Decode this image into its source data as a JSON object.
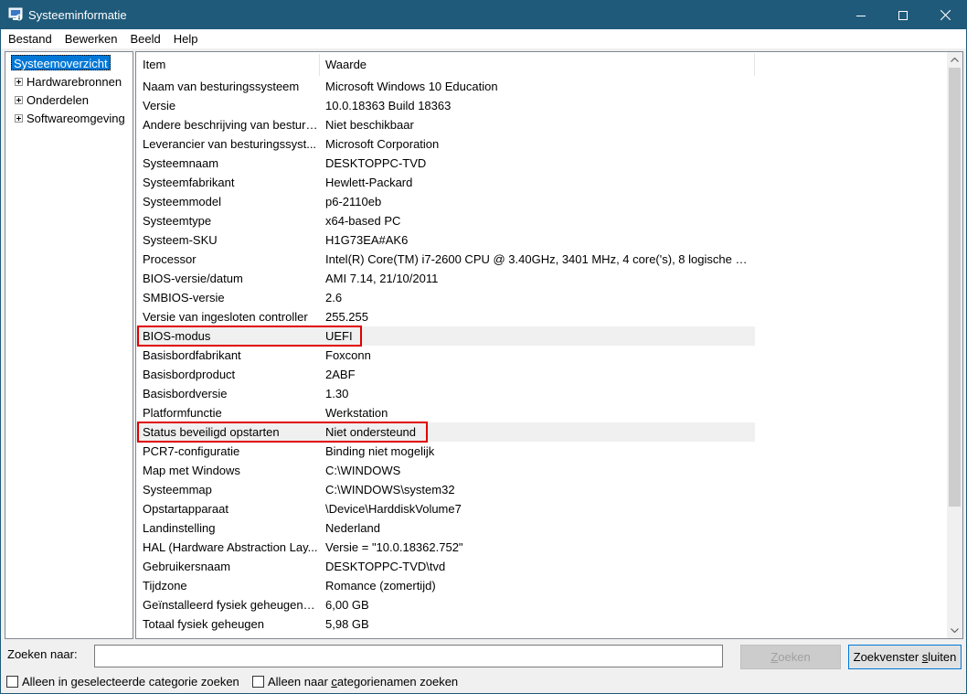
{
  "window": {
    "title": "Systeeminformatie",
    "accent_color": "#1f5a7a"
  },
  "menu": [
    "Bestand",
    "Bewerken",
    "Beeld",
    "Help"
  ],
  "tree": {
    "root": "Systeemoverzicht",
    "children": [
      "Hardwarebronnen",
      "Onderdelen",
      "Softwareomgeving"
    ]
  },
  "table": {
    "headers": [
      "Item",
      "Waarde"
    ],
    "rows": [
      [
        "Naam van besturingssysteem",
        "Microsoft Windows 10 Education"
      ],
      [
        "Versie",
        "10.0.18363 Build 18363"
      ],
      [
        "Andere beschrijving van besturi...",
        "Niet beschikbaar"
      ],
      [
        "Leverancier van besturingssyst...",
        "Microsoft Corporation"
      ],
      [
        "Systeemnaam",
        "DESKTOPPC-TVD"
      ],
      [
        "Systeemfabrikant",
        "Hewlett-Packard"
      ],
      [
        "Systeemmodel",
        "p6-2110eb"
      ],
      [
        "Systeemtype",
        "x64-based PC"
      ],
      [
        "Systeem-SKU",
        "H1G73EA#AK6"
      ],
      [
        "Processor",
        "Intel(R) Core(TM) i7-2600 CPU @ 3.40GHz, 3401 MHz, 4 core('s), 8 logische pr..."
      ],
      [
        "BIOS-versie/datum",
        "AMI 7.14, 21/10/2011"
      ],
      [
        "SMBIOS-versie",
        "2.6"
      ],
      [
        "Versie van ingesloten controller",
        "255.255"
      ],
      [
        "BIOS-modus",
        "UEFI"
      ],
      [
        "Basisbordfabrikant",
        "Foxconn"
      ],
      [
        "Basisbordproduct",
        "2ABF"
      ],
      [
        "Basisbordversie",
        "1.30"
      ],
      [
        "Platformfunctie",
        "Werkstation"
      ],
      [
        "Status beveiligd opstarten",
        "Niet ondersteund"
      ],
      [
        "PCR7-configuratie",
        "Binding niet mogelijk"
      ],
      [
        "Map met Windows",
        "C:\\WINDOWS"
      ],
      [
        "Systeemmap",
        "C:\\WINDOWS\\system32"
      ],
      [
        "Opstartapparaat",
        "\\Device\\HarddiskVolume7"
      ],
      [
        "Landinstelling",
        "Nederland"
      ],
      [
        "HAL (Hardware Abstraction Lay...",
        "Versie = \"10.0.18362.752\""
      ],
      [
        "Gebruikersnaam",
        "DESKTOPPC-TVD\\tvd"
      ],
      [
        "Tijdzone",
        "Romance (zomertijd)"
      ],
      [
        "Geïnstalleerd fysiek geheugen (...",
        "6,00 GB"
      ],
      [
        "Totaal fysiek geheugen",
        "5,98 GB"
      ]
    ],
    "shaded_rows": [
      13,
      18
    ],
    "highlighted_rows": [
      13,
      18
    ],
    "highlight_color": "#e00000"
  },
  "search": {
    "label": "Zoeken naar:",
    "value": "",
    "find_button": "Zoeken",
    "close_button": "Zoekvenster sluiten",
    "option_selected_category": "Alleen in geselecteerde categorie zoeken",
    "option_category_names": "Alleen naar categorienamen zoeken"
  }
}
